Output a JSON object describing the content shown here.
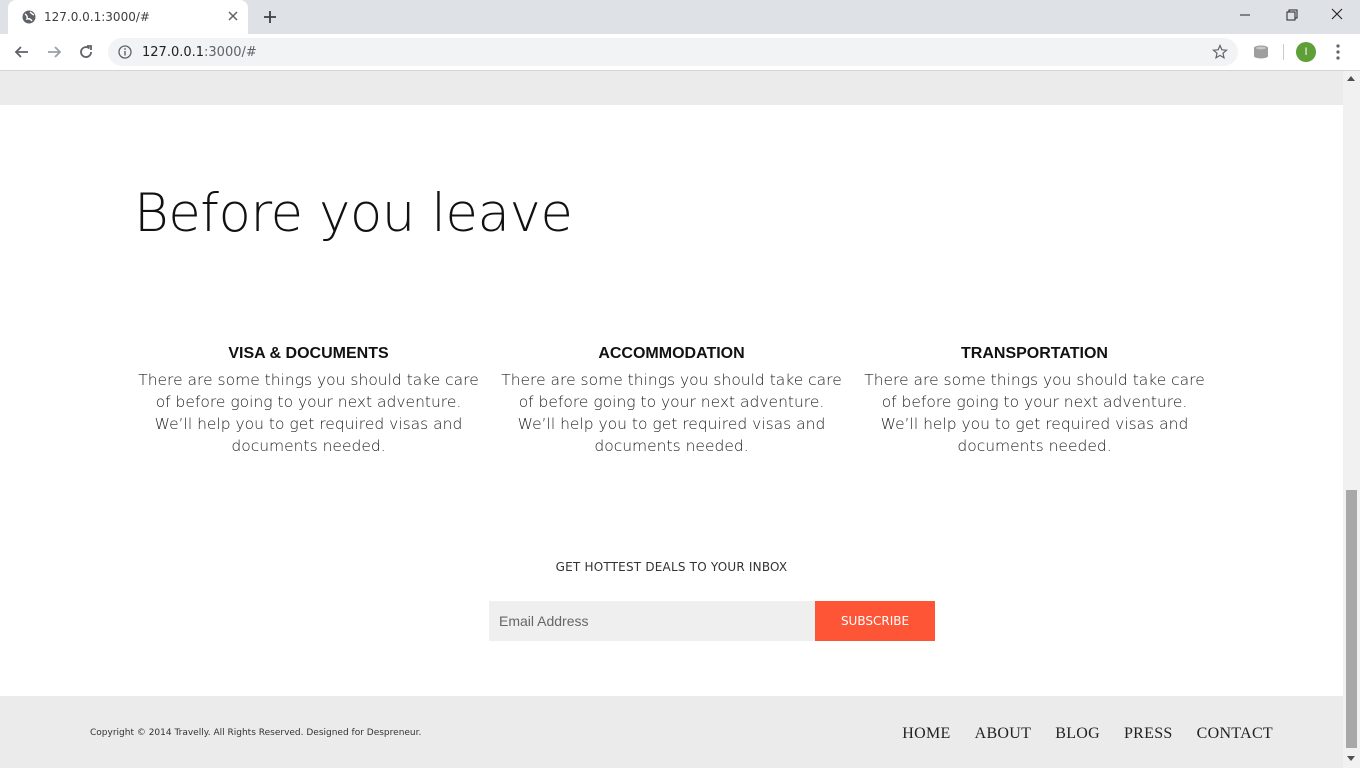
{
  "browser": {
    "tab_title": "127.0.0.1:3000/#",
    "url_host": "127.0.0.1",
    "url_rest": ":3000/#",
    "profile_initial": "I"
  },
  "page": {
    "heading": "Before you leave",
    "columns": [
      {
        "title": "VISA & DOCUMENTS",
        "text": "There are some things you should take care of before going to your next adventure. We’ll help you to get required visas and documents needed."
      },
      {
        "title": "ACCOMMODATION",
        "text": "There are some things you should take care of before going to your next adventure. We’ll help you to get required visas and documents needed."
      },
      {
        "title": "TRANSPORTATION",
        "text": "There are some things you should take care of before going to your next adventure. We’ll help you to get required visas and documents needed."
      }
    ],
    "newsletter": {
      "label": "GET HOTTEST DEALS TO YOUR INBOX",
      "email_placeholder": "Email Address",
      "button": "SUBSCRIBE"
    },
    "footer": {
      "copyright": "Copyright © 2014 Travelly. All Rights Reserved. Designed for Despreneur.",
      "nav": [
        "HOME",
        "ABOUT",
        "BLOG",
        "PRESS",
        "CONTACT"
      ]
    }
  },
  "colors": {
    "accent": "#ff5537",
    "footer_bg": "#ebebeb"
  }
}
